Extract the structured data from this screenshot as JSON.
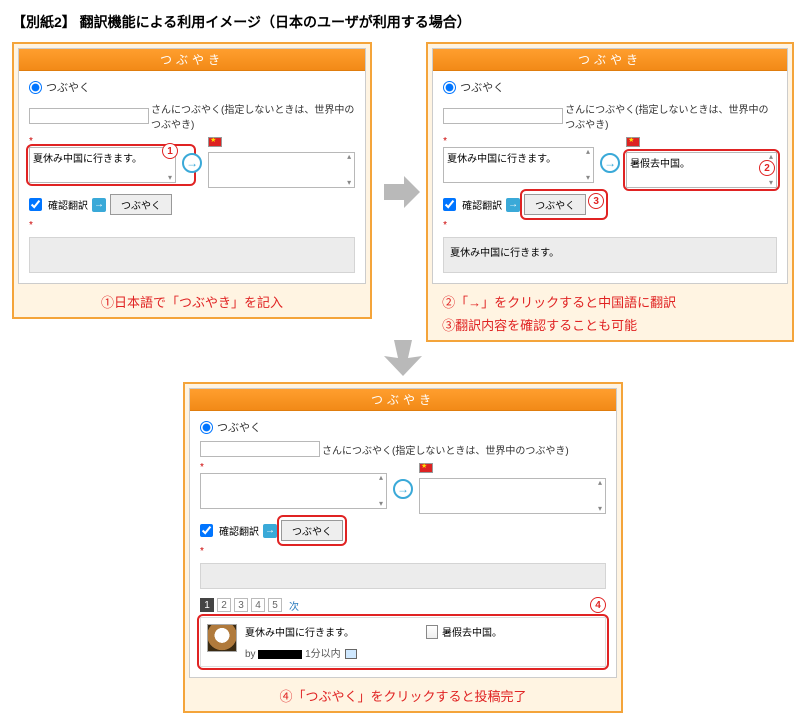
{
  "title": "【別紙2】 翻訳機能による利用イメージ（日本のユーザが利用する場合）",
  "app_header": "つぶやき",
  "radio_label": "つぶやく",
  "addr_suffix": "さんにつぶやく(指定しないときは、世界中のつぶやき)",
  "input_text_jp": "夏休み中国に行きます。",
  "input_text_cn": "暑假去中国。",
  "confirm_label": "確認翻訳",
  "submit_label": "つぶやく",
  "pager": {
    "pages": [
      "1",
      "2",
      "3",
      "4",
      "5"
    ],
    "next": "次"
  },
  "post": {
    "jp": "夏休み中国に行きます。",
    "cn": "暑假去中国。",
    "by_prefix": "by",
    "time_suffix": "1分以内"
  },
  "captions": {
    "a": "①日本語で「つぶやき」を記入",
    "b1": "②「→」をクリックすると中国語に翻訳",
    "b2": "③翻訳内容を確認することも可能",
    "c": "④「つぶやく」をクリックすると投稿完了"
  },
  "markers": {
    "m1": "1",
    "m2": "2",
    "m3": "3",
    "m4": "4"
  }
}
